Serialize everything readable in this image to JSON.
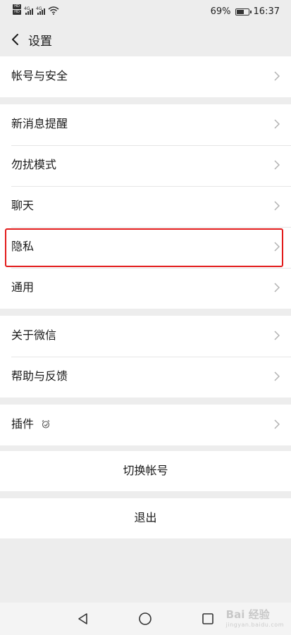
{
  "status_bar": {
    "hd_labels": [
      "HD",
      "HD"
    ],
    "net_labels": [
      "4G",
      "4G"
    ],
    "battery_level": 0.69,
    "battery_text": "69%",
    "time": "16:37"
  },
  "title_bar": {
    "back_icon": "chevron-left-icon",
    "title": "设置"
  },
  "settings": {
    "group1": [
      {
        "label": "帐号与安全"
      }
    ],
    "group2": [
      {
        "label": "新消息提醒"
      },
      {
        "label": "勿扰模式"
      },
      {
        "label": "聊天"
      },
      {
        "label": "隐私",
        "highlighted": true
      },
      {
        "label": "通用"
      }
    ],
    "group3": [
      {
        "label": "关于微信"
      },
      {
        "label": "帮助与反馈"
      }
    ],
    "group4": [
      {
        "label": "插件",
        "icon": "plugin-icon"
      }
    ]
  },
  "actions": {
    "switch_account": "切换帐号",
    "logout": "退出"
  },
  "colors": {
    "background": "#ededed",
    "card": "#ffffff",
    "highlight_border": "#e21b1b"
  },
  "nav_bar": {
    "icons": [
      "back-triangle-icon",
      "home-circle-icon",
      "recents-square-icon"
    ]
  },
  "watermark": {
    "text": "Bai 经验",
    "subtext": "jingyan.baidu.com"
  }
}
